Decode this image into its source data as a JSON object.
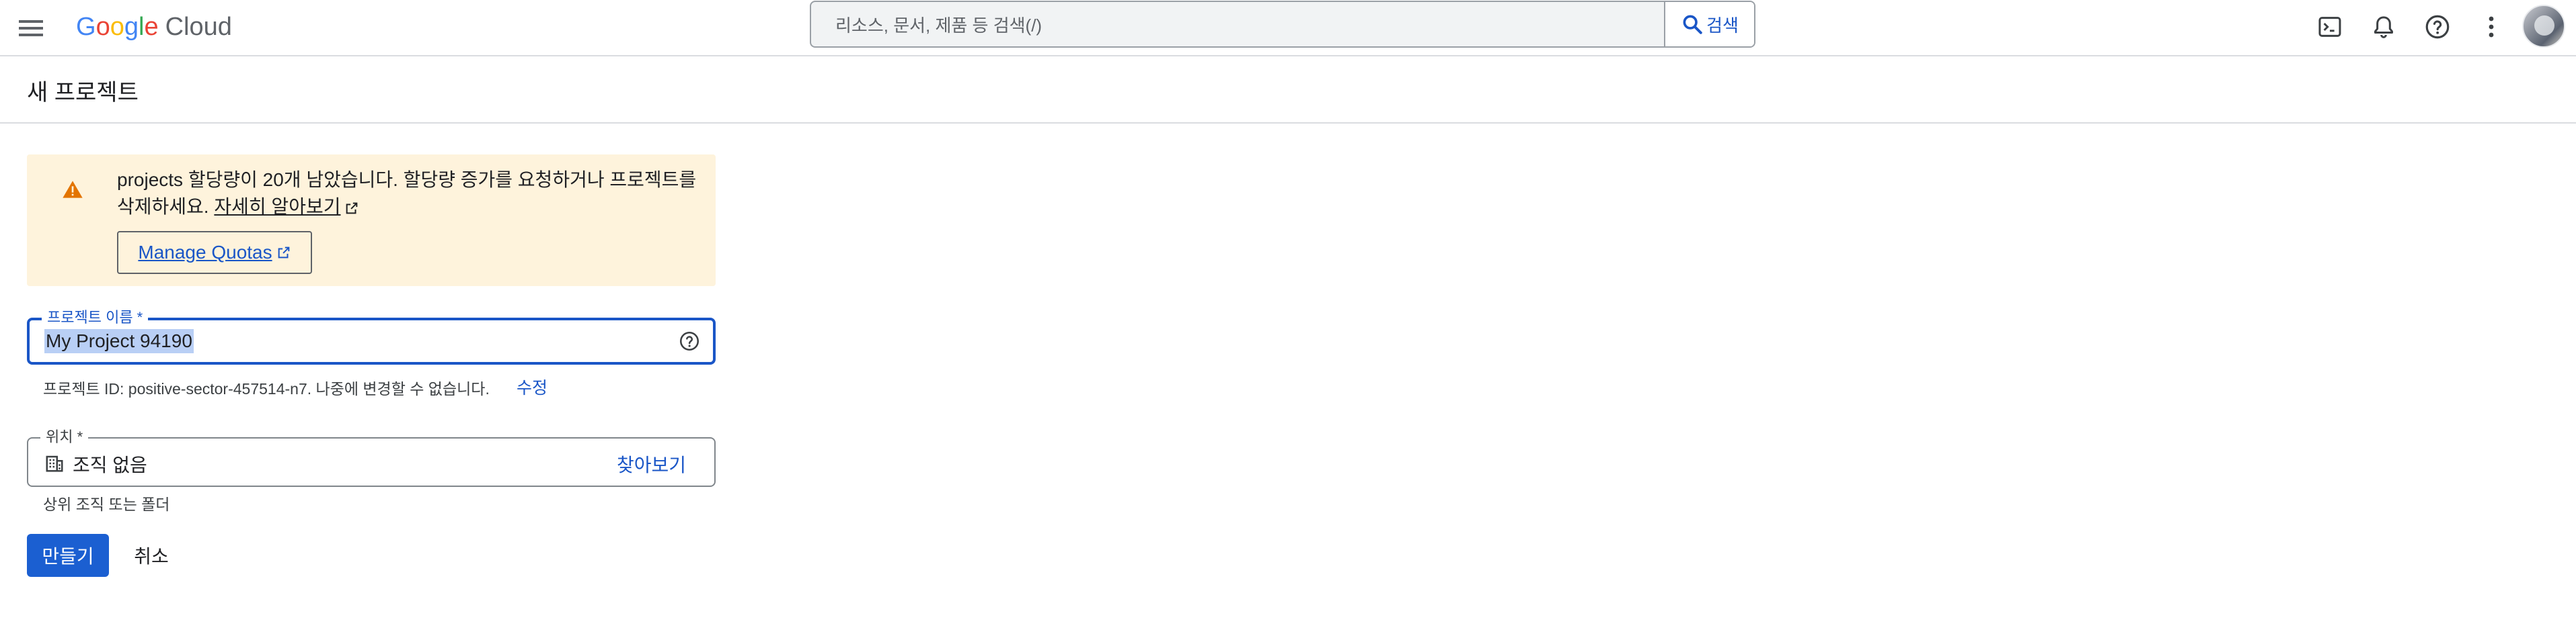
{
  "topbar": {
    "logo_letters": [
      {
        "ch": "G",
        "color": "#4285F4"
      },
      {
        "ch": "o",
        "color": "#EA4335"
      },
      {
        "ch": "o",
        "color": "#FBBC05"
      },
      {
        "ch": "g",
        "color": "#4285F4"
      },
      {
        "ch": "l",
        "color": "#34A853"
      },
      {
        "ch": "e",
        "color": "#EA4335"
      }
    ],
    "logo_product": "Cloud",
    "search_placeholder": "리소스, 문서, 제품 등 검색(/)",
    "search_button": "검색",
    "icons": [
      "menu-icon",
      "cloud-shell-icon",
      "notifications-icon",
      "help-icon",
      "more-vert-icon",
      "avatar"
    ]
  },
  "page": {
    "title": "새 프로젝트"
  },
  "banner": {
    "message": "projects 할당량이 20개 남았습니다. 할당량 증가를 요청하거나 프로젝트를 삭제하세요.",
    "learn_more": "자세히 알아보기",
    "manage_quotas": "Manage Quotas",
    "warning_color": "#E37400"
  },
  "project_name": {
    "label": "프로젝트 이름 *",
    "value": "My Project 94190",
    "project_id_text": "프로젝트 ID: positive-sector-457514-n7. 나중에 변경할 수 없습니다.",
    "edit_label": "수정"
  },
  "location": {
    "label": "위치 *",
    "value": "조직 없음",
    "browse_label": "찾아보기",
    "helper": "상위 조직 또는 폴더"
  },
  "actions": {
    "create": "만들기",
    "cancel": "취소"
  },
  "colors": {
    "accent": "#1A56C7",
    "primary_button": "#1B5FD1",
    "banner_bg": "#FEF3DC",
    "selection": "#B9CFF5"
  }
}
